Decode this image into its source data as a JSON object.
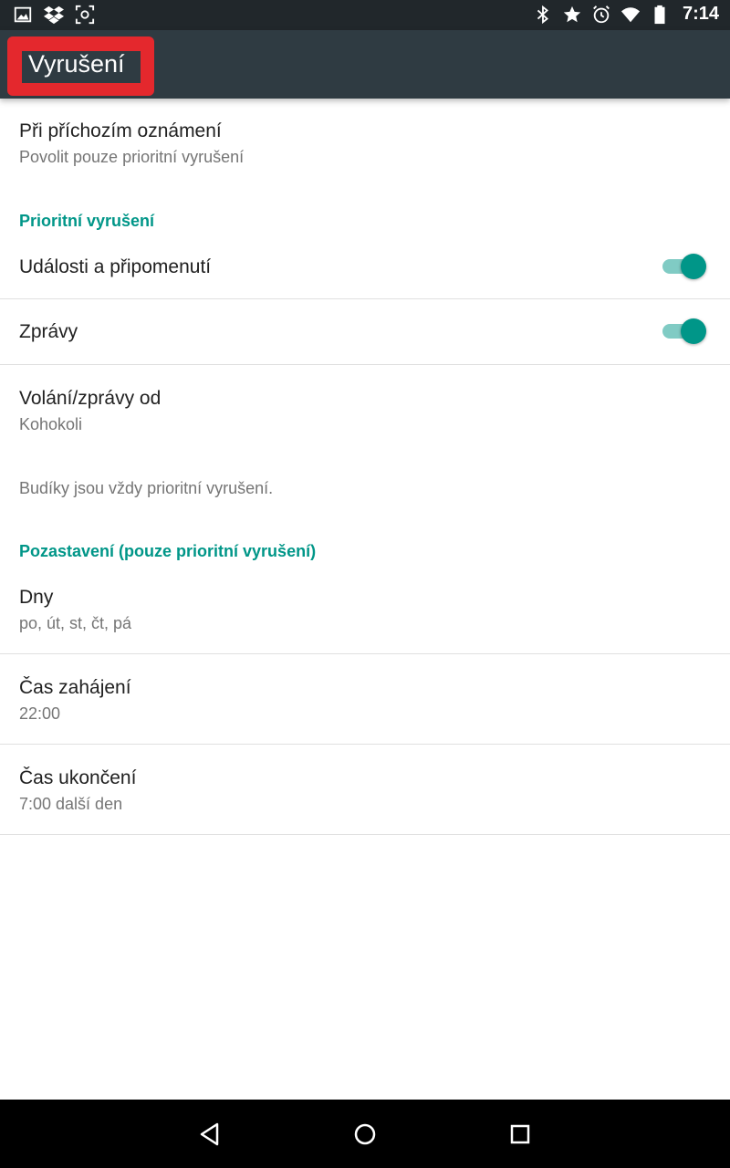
{
  "status_bar": {
    "time": "7:14",
    "left_icons": [
      "image-icon",
      "dropbox-icon",
      "screenshot-icon"
    ],
    "right_icons": [
      "bluetooth-icon",
      "star-icon",
      "alarm-icon",
      "wifi-icon",
      "battery-icon"
    ]
  },
  "toolbar": {
    "title": "Vyrušení",
    "highlight_color": "#e4282d"
  },
  "settings": {
    "incoming": {
      "title": "Při příchozím oznámení",
      "subtitle": "Povolit pouze prioritní vyrušení"
    },
    "priority_header": "Prioritní vyrušení",
    "events": {
      "title": "Události a připomenutí",
      "enabled": true
    },
    "messages": {
      "title": "Zprávy",
      "enabled": true
    },
    "calls_from": {
      "title": "Volání/zprávy od",
      "subtitle": "Kohokoli"
    },
    "alarms_note": "Budíky jsou vždy prioritní vyrušení.",
    "downtime_header": "Pozastavení (pouze prioritní vyrušení)",
    "days": {
      "title": "Dny",
      "subtitle": "po, út, st, čt, pá"
    },
    "start_time": {
      "title": "Čas zahájení",
      "subtitle": "22:00"
    },
    "end_time": {
      "title": "Čas ukončení",
      "subtitle": "7:00 další den"
    }
  },
  "colors": {
    "accent": "#009688",
    "toolbar": "#2f3b42",
    "status_bar": "#21272b"
  },
  "nav_bar": {
    "buttons": [
      "back-icon",
      "home-icon",
      "recents-icon"
    ]
  }
}
